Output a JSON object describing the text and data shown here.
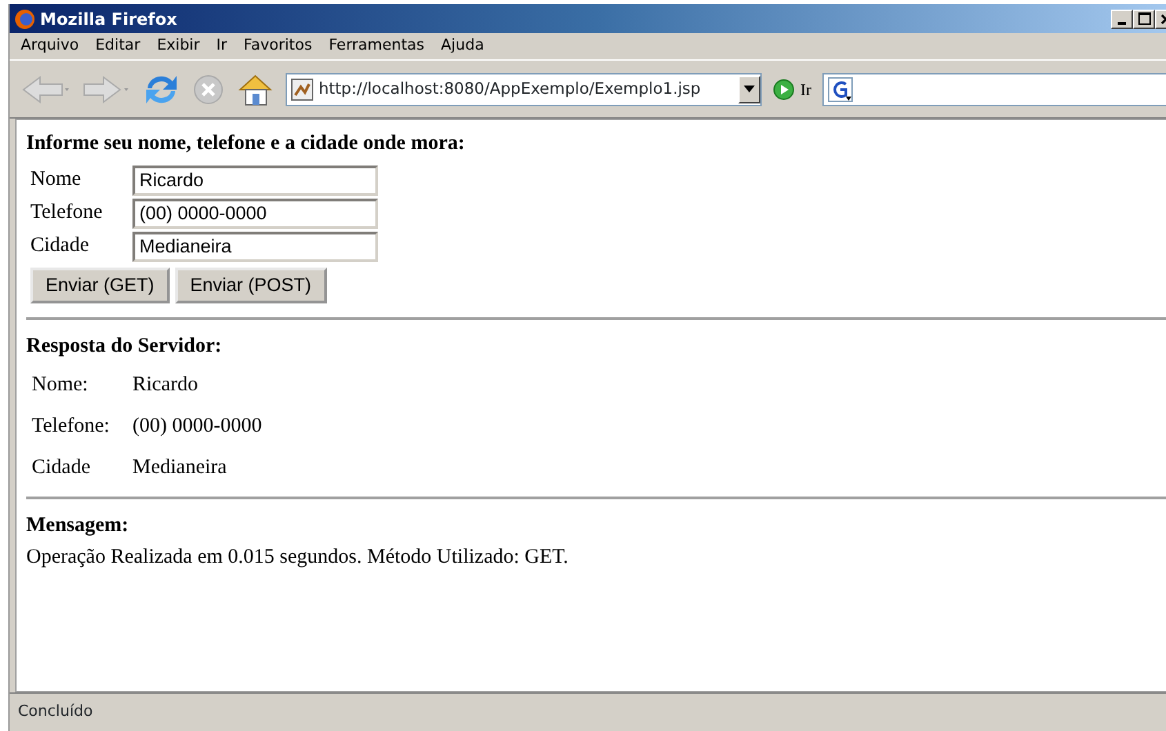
{
  "window": {
    "title": "Mozilla Firefox"
  },
  "menu": [
    "Arquivo",
    "Editar",
    "Exibir",
    "Ir",
    "Favoritos",
    "Ferramentas",
    "Ajuda"
  ],
  "toolbar": {
    "address": "http://localhost:8080/AppExemplo/Exemplo1.jsp",
    "go_label": "Ir"
  },
  "form": {
    "heading": "Informe seu nome, telefone e a cidade onde mora:",
    "fields": [
      {
        "label": "Nome",
        "value": "Ricardo"
      },
      {
        "label": "Telefone",
        "value": "(00) 0000-0000"
      },
      {
        "label": "Cidade",
        "value": "Medianeira"
      }
    ],
    "buttons": [
      "Enviar (GET)",
      "Enviar (POST)"
    ]
  },
  "response": {
    "heading": "Resposta do Servidor:",
    "rows": [
      {
        "label": "Nome:",
        "value": "Ricardo"
      },
      {
        "label": "Telefone:",
        "value": "(00) 0000-0000"
      },
      {
        "label": "Cidade",
        "value": "Medianeira"
      }
    ]
  },
  "message": {
    "heading": "Mensagem:",
    "text": "Operação Realizada em 0.015 segundos. Método Utilizado: GET."
  },
  "status_bar": "Concluído"
}
